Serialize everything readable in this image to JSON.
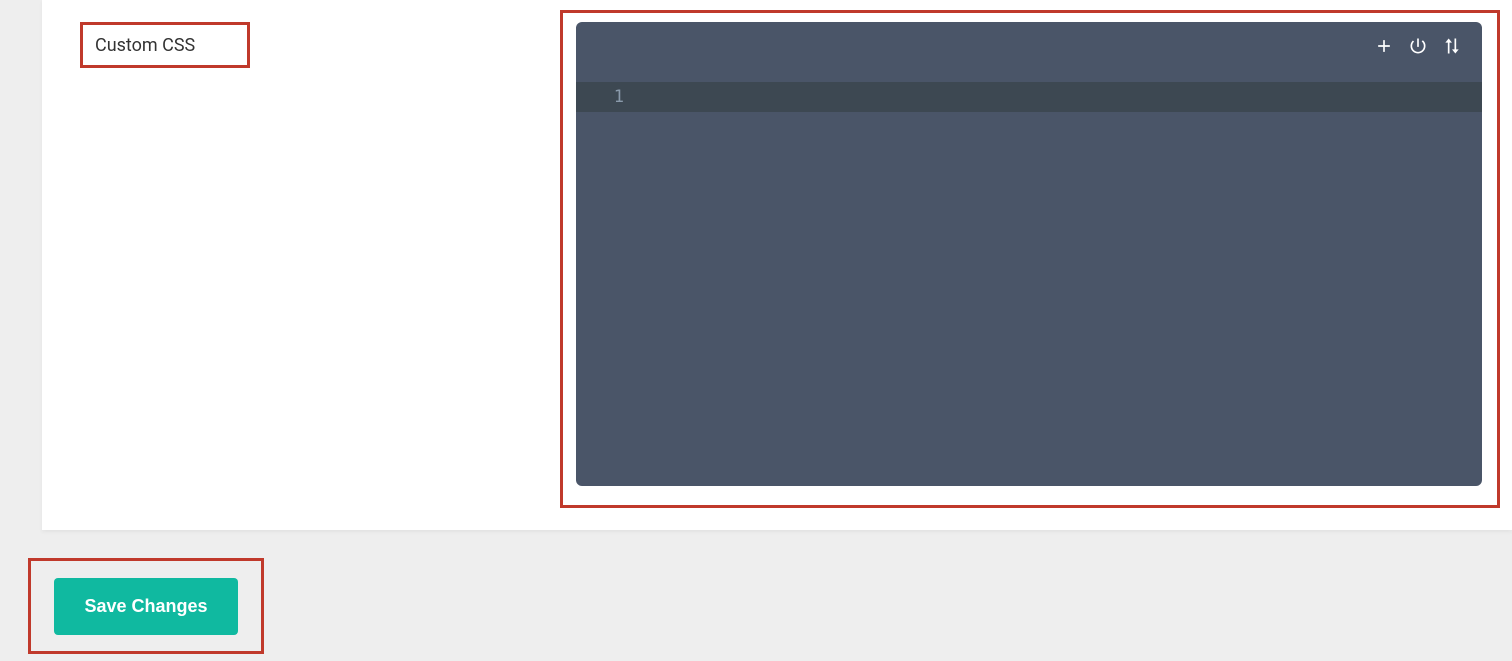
{
  "field": {
    "label": "Custom CSS"
  },
  "editor": {
    "line_number": "1",
    "content": ""
  },
  "actions": {
    "save_label": "Save Changes"
  }
}
